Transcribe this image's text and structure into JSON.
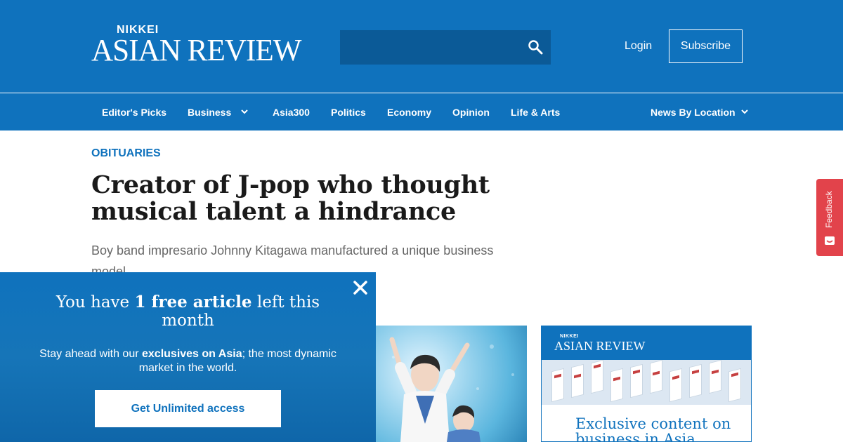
{
  "header": {
    "logo_small": "NIKKEI",
    "logo_big": "ASIAN REVIEW",
    "search_icon": "search-icon",
    "login_label": "Login",
    "subscribe_label": "Subscribe"
  },
  "nav": {
    "items": [
      {
        "label": "Editor's Picks"
      },
      {
        "label": "Business"
      },
      {
        "label": "Asia300"
      },
      {
        "label": "Politics"
      },
      {
        "label": "Economy"
      },
      {
        "label": "Opinion"
      },
      {
        "label": "Life & Arts"
      },
      {
        "label": "News By Location"
      }
    ]
  },
  "article": {
    "kicker": "OBITUARIES",
    "headline": "Creator of J-pop who thought musical talent a hindrance",
    "subhead": "Boy band impresario Johnny Kitagawa manufactured a unique business model"
  },
  "ad": {
    "logo_small": "NIKKEI",
    "logo_big": "ASIAN REVIEW",
    "text": "Exclusive content on business in Asia"
  },
  "feedback": {
    "label": "Feedback"
  },
  "paywall": {
    "title_pre": "You have ",
    "title_bold": "1 free article",
    "title_post": " left this month",
    "desc_pre": "Stay ahead with our ",
    "desc_bold": "exclusives on Asia",
    "desc_post": "; the most dynamic market in the world.",
    "button_label": "Get Unlimited access"
  },
  "colors": {
    "brand_blue": "#0f72bd",
    "search_bg": "#0b5a97",
    "feedback_red": "#e2434b"
  }
}
